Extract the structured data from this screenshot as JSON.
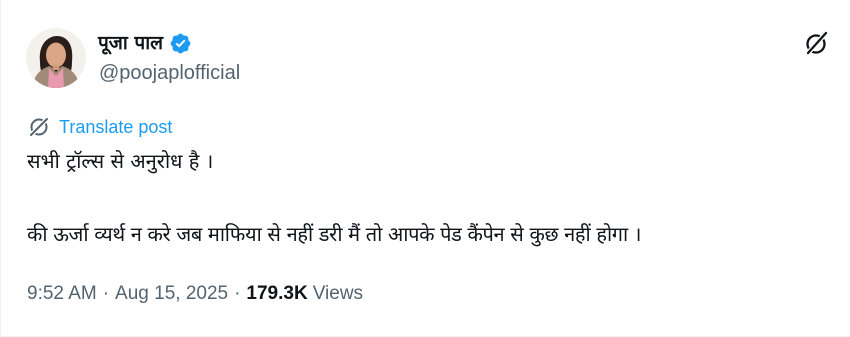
{
  "author": {
    "display_name": "पूजा पाल",
    "handle": "@poojaplofficial",
    "verified": true,
    "avatar_icon": "profile-photo",
    "verified_icon": "verified-badge-icon",
    "verified_color": "#1d9bf0"
  },
  "header": {
    "grok_icon": "grok-icon"
  },
  "translate": {
    "icon": "translate-globe-icon",
    "label": "Translate post",
    "color": "#1d9bf0"
  },
  "post": {
    "lines": [
      "सभी ट्रॉल्स से अनुरोध है ।",
      "की ऊर्जा व्यर्थ न करे जब माफिया से नहीं डरी मैं तो आपके पेड कैंपेन से कुछ नहीं होगा ।"
    ]
  },
  "meta": {
    "time": "9:52 AM",
    "separator": "·",
    "date": "Aug 15, 2025",
    "views_count": "179.3K",
    "views_label": "Views",
    "text_color": "#536471"
  }
}
